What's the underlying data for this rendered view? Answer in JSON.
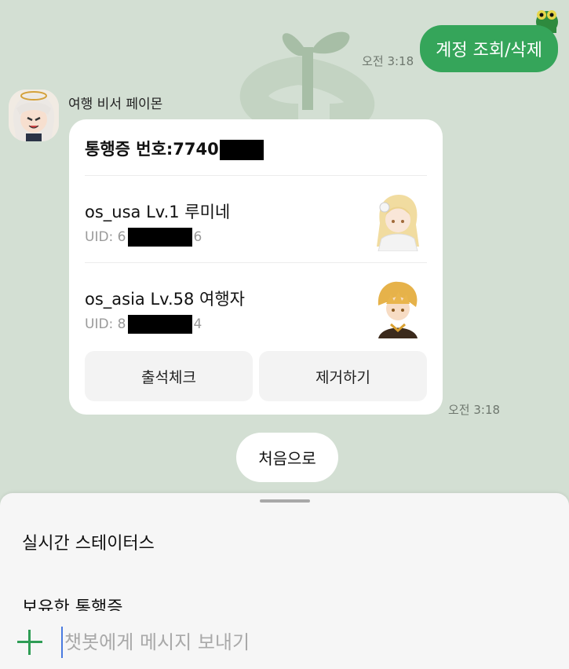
{
  "user_message": {
    "text": "계정 조회/삭제",
    "time": "오전 3:18"
  },
  "bot": {
    "name": "여행 비서 페이몬",
    "card": {
      "title_prefix": "통행증 번호:7740",
      "accounts": [
        {
          "name": "os_usa Lv.1 루미네",
          "uid_prefix": "UID: 6",
          "uid_suffix": "6"
        },
        {
          "name": "os_asia Lv.58 여행자",
          "uid_prefix": "UID: 8",
          "uid_suffix": "4"
        }
      ],
      "buttons": {
        "checkin": "출석체크",
        "remove": "제거하기"
      }
    },
    "time": "오전 3:18"
  },
  "home_button": "처음으로",
  "sheet": {
    "items": [
      "실시간 스테이터스",
      "보유한 통행증"
    ]
  },
  "composer": {
    "placeholder": "챗봇에게 메시지 보내기"
  },
  "colors": {
    "accent": "#35a55a",
    "background": "#d3dfd3"
  }
}
